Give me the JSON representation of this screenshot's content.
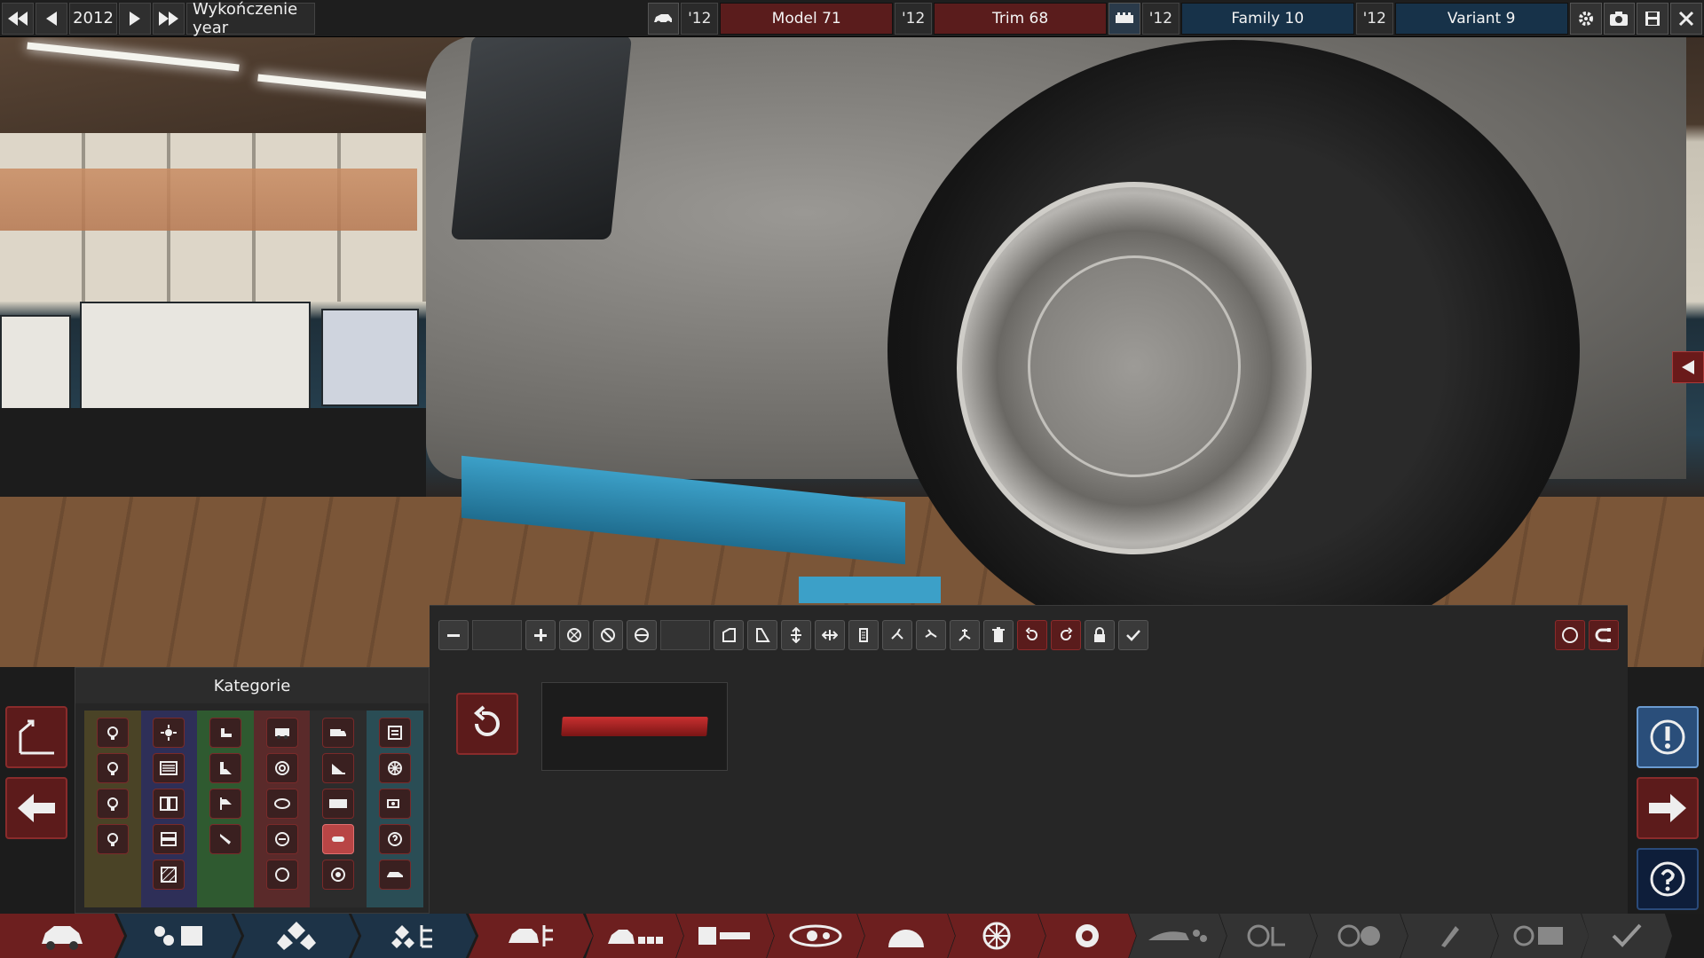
{
  "topbar": {
    "year": "2012",
    "year_label": "Wykończenie year",
    "model_year": "'12",
    "model": "Model 71",
    "trim_year": "'12",
    "trim": "Trim 68",
    "family_year": "'12",
    "family": "Family 10",
    "variant_year": "'12",
    "variant": "Variant 9"
  },
  "category_panel": {
    "title": "Kategorie",
    "column_colors": [
      "#4a4326",
      "#2e2f58",
      "#2f5a30",
      "#5a2a2a",
      "#2c2c2c",
      "#2a4d55"
    ]
  },
  "colors": {
    "accent_red": "#5c1b1b",
    "accent_blue": "#173249",
    "part_red": "#c83030"
  }
}
